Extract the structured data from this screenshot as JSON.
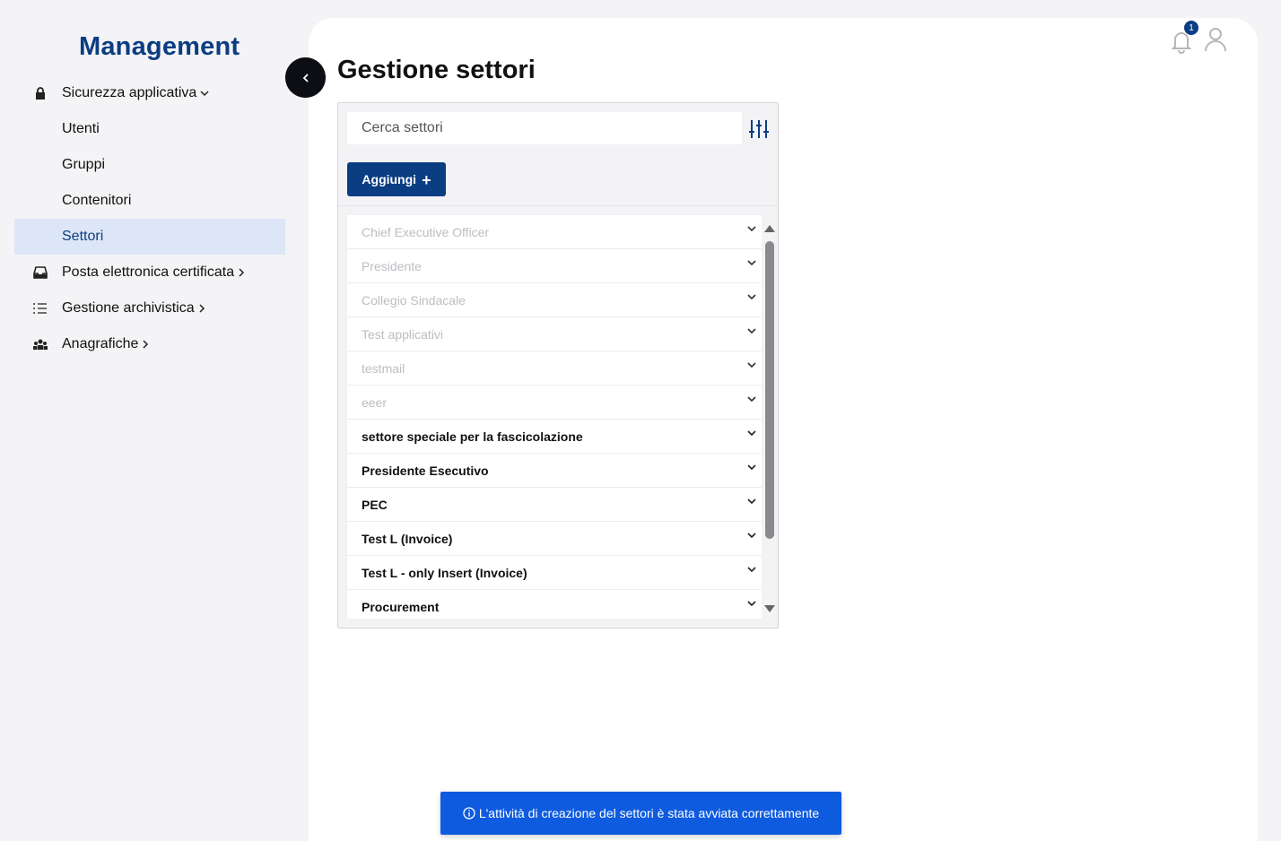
{
  "brand": "Management",
  "sidebar": {
    "items": [
      {
        "label": "Sicurezza applicativa",
        "icon": "lock-icon",
        "chevron": "down"
      },
      {
        "label": "Utenti"
      },
      {
        "label": "Gruppi"
      },
      {
        "label": "Contenitori"
      },
      {
        "label": "Settori",
        "active": true
      },
      {
        "label": "Posta elettronica certificata",
        "icon": "inbox-icon",
        "chevron": "right"
      },
      {
        "label": "Gestione archivistica",
        "icon": "list-icon",
        "chevron": "right"
      },
      {
        "label": "Anagrafiche",
        "icon": "people-icon",
        "chevron": "right"
      }
    ]
  },
  "header": {
    "title": "Gestione settori",
    "notification_count": "1"
  },
  "search": {
    "placeholder": "Cerca settori",
    "value": ""
  },
  "toolbar": {
    "add_label": "Aggiungi",
    "add_icon": "+"
  },
  "sectors": [
    {
      "name": "Chief Executive Officer",
      "disabled": true
    },
    {
      "name": "Presidente",
      "disabled": true
    },
    {
      "name": "Collegio Sindacale",
      "disabled": true
    },
    {
      "name": "Test applicativi",
      "disabled": true
    },
    {
      "name": "testmail",
      "disabled": true
    },
    {
      "name": "eeer",
      "disabled": true
    },
    {
      "name": "settore speciale per la fascicolazione",
      "disabled": false
    },
    {
      "name": "Presidente Esecutivo",
      "disabled": false
    },
    {
      "name": "PEC",
      "disabled": false
    },
    {
      "name": "Test L (Invoice)",
      "disabled": false
    },
    {
      "name": "Test L - only Insert (Invoice)",
      "disabled": false
    },
    {
      "name": "Procurement",
      "disabled": false
    }
  ],
  "toast": {
    "message": "L'attività di creazione del settori è stata avviata correttamente",
    "icon": "info-icon"
  },
  "colors": {
    "brand": "#0b3d82",
    "active_bg": "#dde6f7",
    "toast_bg": "#0e5bdf",
    "disabled_text": "#bdbdc3"
  }
}
